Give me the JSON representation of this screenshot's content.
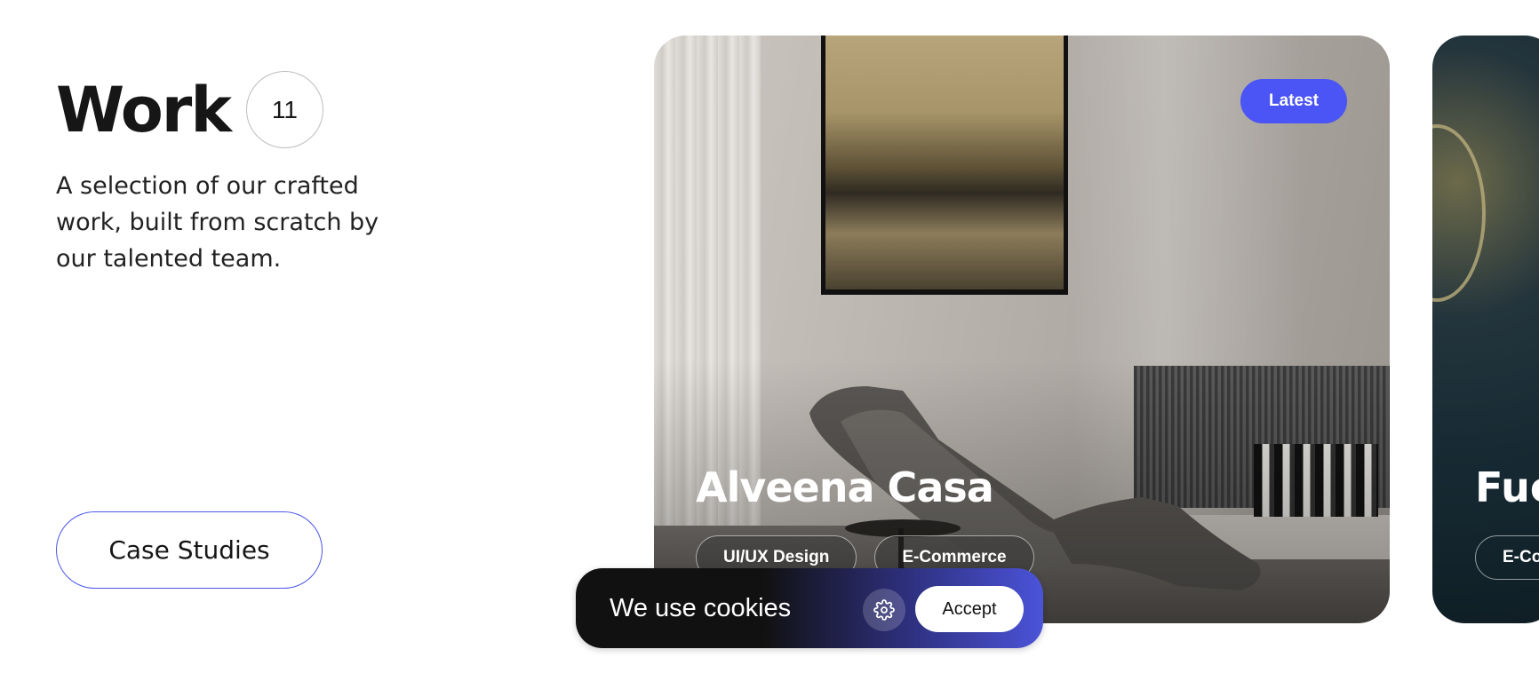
{
  "header": {
    "title": "Work",
    "count": "11",
    "description": "A selection of our crafted work, built from scratch by our talented team."
  },
  "cta": {
    "label": "Case Studies"
  },
  "cards": [
    {
      "badge": "Latest",
      "title": "Alveena Casa",
      "tags": [
        "UI/UX Design",
        "E-Commerce"
      ]
    },
    {
      "title": "Fuc",
      "tags": [
        "E-Co"
      ]
    }
  ],
  "cookie_banner": {
    "text": "We use cookies",
    "settings_icon": "gear-icon",
    "accept_label": "Accept"
  },
  "colors": {
    "accent": "#4b54f5",
    "text": "#161616",
    "banner_dark": "#111111"
  }
}
